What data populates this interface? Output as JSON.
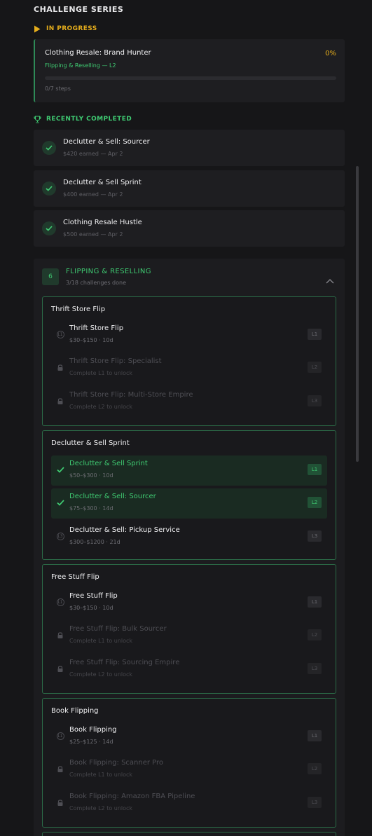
{
  "page": {
    "title": "CHALLENGE SERIES"
  },
  "in_progress": {
    "label": "IN PROGRESS",
    "title": "Clothing Resale: Brand Hunter",
    "subtitle": "Flipping & Reselling — L2",
    "percent": "0%",
    "progress_fraction": 0,
    "steps": "0/7 steps"
  },
  "recently_completed": {
    "label": "RECENTLY COMPLETED",
    "items": [
      {
        "title": "Declutter & Sell: Sourcer",
        "meta": "$420 earned — Apr 2"
      },
      {
        "title": "Declutter & Sell Sprint",
        "meta": "$400 earned — Apr 2"
      },
      {
        "title": "Clothing Resale Hustle",
        "meta": "$500 earned — Apr 2"
      }
    ]
  },
  "category": {
    "badge": "6",
    "title": "FLIPPING & RESELLING",
    "subtitle": "3/18 challenges done",
    "series": [
      {
        "title": "Thrift Store Flip",
        "levels": [
          {
            "title": "Thrift Store Flip",
            "meta": "$30–$150 · 10d",
            "badge": "L1",
            "state": "available",
            "icon": "L1"
          },
          {
            "title": "Thrift Store Flip: Specialist",
            "meta": "Complete L1 to unlock",
            "badge": "L2",
            "state": "locked"
          },
          {
            "title": "Thrift Store Flip: Multi-Store Empire",
            "meta": "Complete L2 to unlock",
            "badge": "L3",
            "state": "locked"
          }
        ]
      },
      {
        "title": "Declutter & Sell Sprint",
        "levels": [
          {
            "title": "Declutter & Sell Sprint",
            "meta": "$50–$300 · 10d",
            "badge": "L1",
            "state": "done"
          },
          {
            "title": "Declutter & Sell: Sourcer",
            "meta": "$75–$300 · 14d",
            "badge": "L2",
            "state": "done"
          },
          {
            "title": "Declutter & Sell: Pickup Service",
            "meta": "$300–$1200 · 21d",
            "badge": "L3",
            "state": "available",
            "icon": "L3"
          }
        ]
      },
      {
        "title": "Free Stuff Flip",
        "levels": [
          {
            "title": "Free Stuff Flip",
            "meta": "$30–$150 · 10d",
            "badge": "L1",
            "state": "available",
            "icon": "L1"
          },
          {
            "title": "Free Stuff Flip: Bulk Sourcer",
            "meta": "Complete L1 to unlock",
            "badge": "L2",
            "state": "locked"
          },
          {
            "title": "Free Stuff Flip: Sourcing Empire",
            "meta": "Complete L2 to unlock",
            "badge": "L3",
            "state": "locked"
          }
        ]
      },
      {
        "title": "Book Flipping",
        "levels": [
          {
            "title": "Book Flipping",
            "meta": "$25–$125 · 14d",
            "badge": "L1",
            "state": "available",
            "icon": "L1"
          },
          {
            "title": "Book Flipping: Scanner Pro",
            "meta": "Complete L1 to unlock",
            "badge": "L2",
            "state": "locked"
          },
          {
            "title": "Book Flipping: Amazon FBA Pipeline",
            "meta": "Complete L2 to unlock",
            "badge": "L3",
            "state": "locked"
          }
        ]
      }
    ]
  },
  "colors": {
    "background": "#161618",
    "card": "#1e1e21",
    "accent_green": "#3fcb72",
    "accent_yellow": "#e5ad1c",
    "muted": "#6d6d73"
  },
  "icons": {
    "in_progress": "play-icon",
    "recently_completed": "trophy-icon",
    "done": "check-icon",
    "locked": "lock-icon",
    "collapse": "chevron-up-icon"
  }
}
